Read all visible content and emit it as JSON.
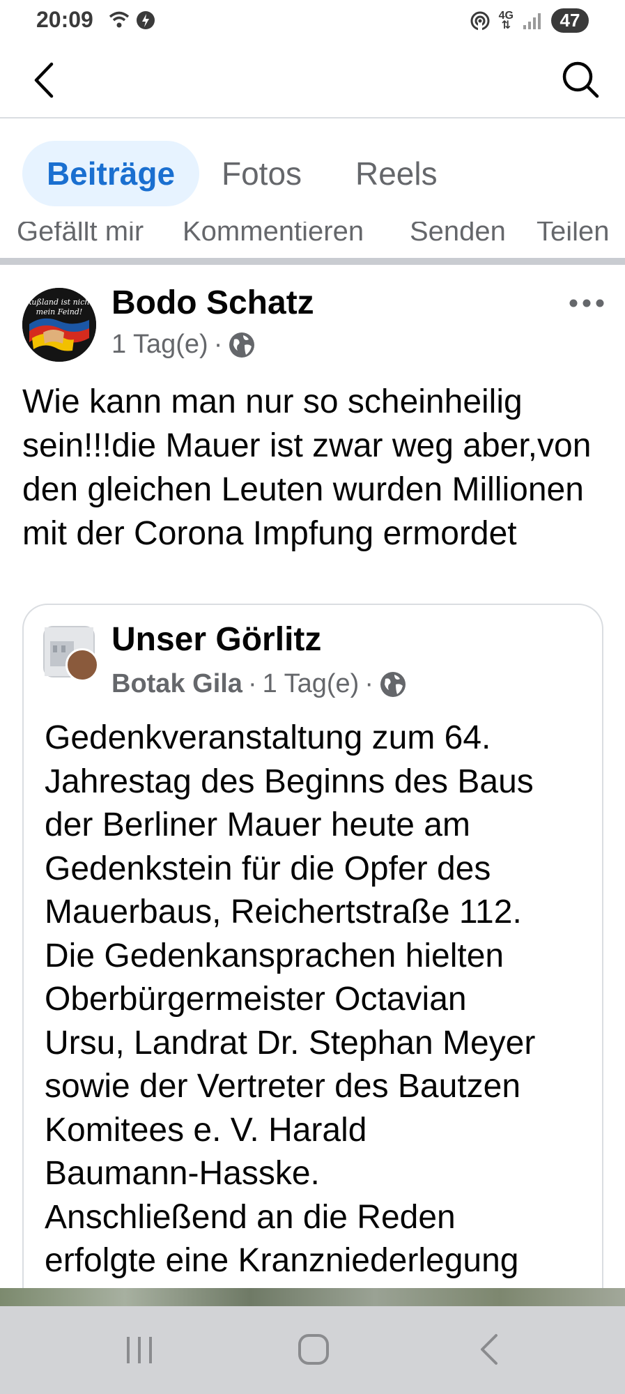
{
  "status_bar": {
    "time": "20:09",
    "network_label_top": "4G",
    "network_label_bottom": "⇅",
    "battery": "47"
  },
  "top_nav": {
    "back_icon": "chevron-left-icon",
    "search_icon": "search-icon"
  },
  "tabs": [
    {
      "label": "Beiträge",
      "active": true
    },
    {
      "label": "Fotos",
      "active": false
    },
    {
      "label": "Reels",
      "active": false
    }
  ],
  "action_strip": {
    "like": "Gefällt mir",
    "comment": "Kommentieren",
    "send": "Senden",
    "share": "Teilen"
  },
  "post": {
    "author": "Bodo Schatz",
    "time": "1 Tag(e)",
    "separator": "·",
    "avatar_text_line1": "Rußland ist nicht",
    "avatar_text_line2": "mein Feind!",
    "text": "Wie kann man nur so scheinheilig sein!!!die Mauer ist zwar weg aber,von den gleichen Leuten wurden Millionen mit der Corona Impfung ermordet"
  },
  "shared_post": {
    "page_name": "Unser Görlitz",
    "sub_author": "Botak Gila",
    "time": "1 Tag(e)",
    "separator": "·",
    "text": "Gedenkveranstaltung zum 64.\nJahrestag des Beginns des Baus\nder Berliner Mauer heute am\nGedenkstein für die Opfer des\nMauerbaus, Reichertstraße 112.\nDie Gedenkansprachen hielten\nOberbürgermeister Octavian\nUrsu, Landrat Dr. Stephan Meyer\nsowie der Vertreter des Bautzen\nKomitees e. V.  Harald\nBaumann-Hasske.\nAnschließend an die Reden\nerfolgte eine Kranzniederlegung"
  },
  "colors": {
    "accent": "#1a6fd0",
    "accent_bg": "#e7f3ff",
    "secondary_text": "#65676b",
    "nav_bar_bg": "#d2d3d6"
  }
}
